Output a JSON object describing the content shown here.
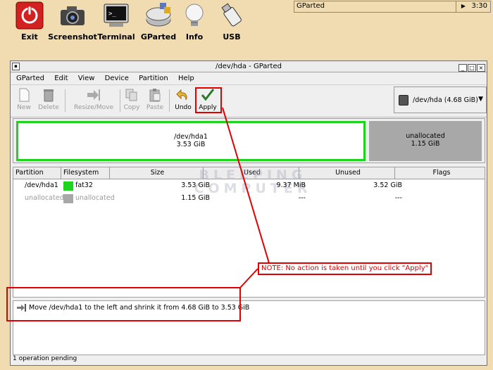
{
  "launcher": {
    "items": [
      {
        "label": "Exit",
        "icon": "power-icon"
      },
      {
        "label": "Screenshot",
        "icon": "camera-icon"
      },
      {
        "label": "Terminal",
        "icon": "terminal-icon"
      },
      {
        "label": "GParted",
        "icon": "gparted-icon"
      },
      {
        "label": "Info",
        "icon": "lightbulb-icon"
      },
      {
        "label": "USB",
        "icon": "usb-icon"
      }
    ]
  },
  "taskbar": {
    "window_button": "GParted",
    "clock": "3:30"
  },
  "window": {
    "title": "/dev/hda - GParted",
    "sys_button": "▪",
    "min": "_",
    "max": "□",
    "close": "×"
  },
  "menu": [
    "GParted",
    "Edit",
    "View",
    "Device",
    "Partition",
    "Help"
  ],
  "toolbar": {
    "new": "New",
    "delete": "Delete",
    "resize": "Resize/Move",
    "copy": "Copy",
    "paste": "Paste",
    "undo": "Undo",
    "apply": "Apply"
  },
  "device": {
    "label": "/dev/hda   (4.68 GiB)"
  },
  "visual": {
    "p1_name": "/dev/hda1",
    "p1_size": "3.53 GiB",
    "p2_name": "unallocated",
    "p2_size": "1.15 GiB"
  },
  "table": {
    "headers": [
      "Partition",
      "Filesystem",
      "Size",
      "Used",
      "Unused",
      "Flags"
    ],
    "rows": [
      {
        "partition": "/dev/hda1",
        "filesystem": "fat32",
        "size": "3.53 GiB",
        "used": "9.37 MiB",
        "unused": "3.52 GiB",
        "flags": ""
      },
      {
        "partition": "unallocated",
        "filesystem": "unallocated",
        "size": "1.15 GiB",
        "used": "---",
        "unused": "---",
        "flags": ""
      }
    ]
  },
  "watermark": {
    "line1": "BLEEPING",
    "line2": "COMPUTER"
  },
  "operations": {
    "items": [
      "Move /dev/hda1 to the left and shrink it from 4.68 GiB to 3.53 GiB"
    ]
  },
  "splitter": "......",
  "status": {
    "text": "1 operation pending"
  },
  "annotation": {
    "note": "NOTE: No action is taken until you click \"Apply\""
  },
  "colors": {
    "fat32": "#1ed41e",
    "unallocated": "#a8a8a8",
    "annotation": "#e00000"
  }
}
